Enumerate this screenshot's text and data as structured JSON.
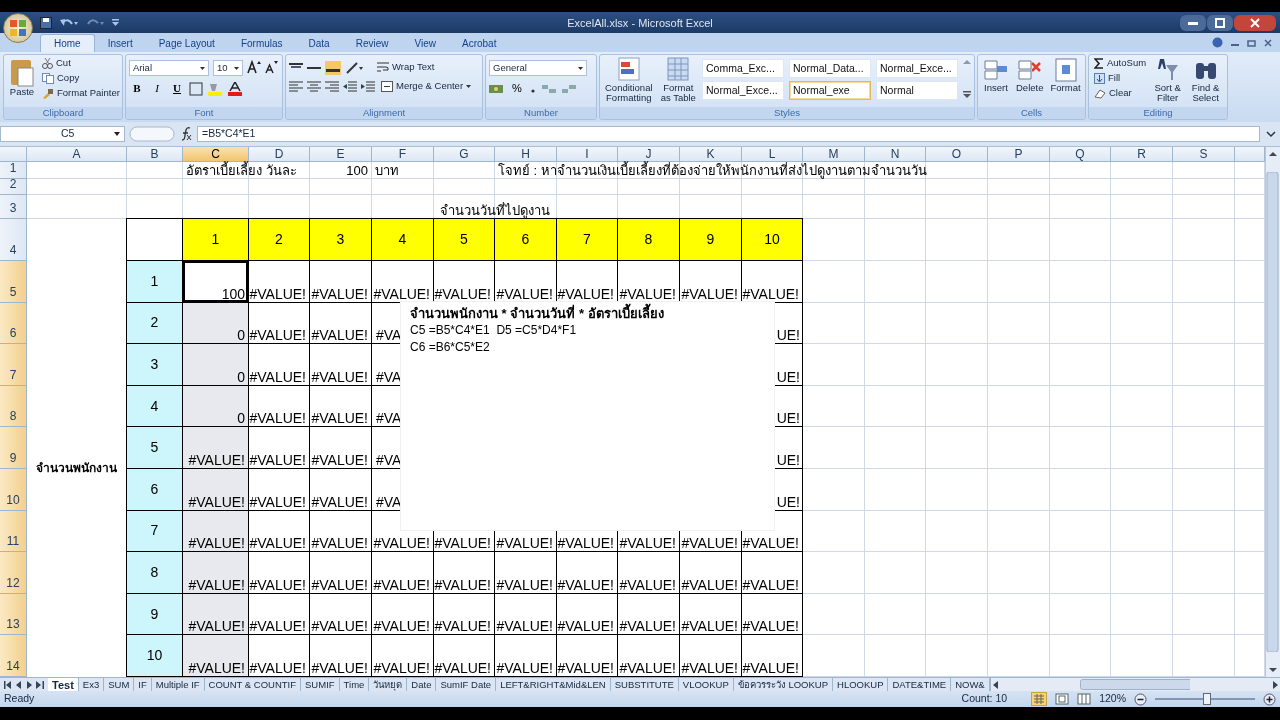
{
  "window": {
    "title": "ExcelAll.xlsx - Microsoft Excel"
  },
  "ribbon_tabs": [
    {
      "label": "Home",
      "selected": true
    },
    {
      "label": "Insert",
      "selected": false
    },
    {
      "label": "Page Layout",
      "selected": false
    },
    {
      "label": "Formulas",
      "selected": false
    },
    {
      "label": "Data",
      "selected": false
    },
    {
      "label": "Review",
      "selected": false
    },
    {
      "label": "View",
      "selected": false
    },
    {
      "label": "Acrobat",
      "selected": false
    }
  ],
  "ribbon": {
    "clipboard": {
      "label": "Clipboard",
      "paste": "Paste",
      "cut": "Cut",
      "copy": "Copy",
      "format_painter": "Format Painter"
    },
    "font": {
      "label": "Font",
      "font_name": "Arial",
      "font_size": "10",
      "bold": "B",
      "italic": "I",
      "underline": "U"
    },
    "alignment": {
      "label": "Alignment",
      "wrap_text": "Wrap Text",
      "merge_center": "Merge & Center"
    },
    "number": {
      "label": "Number",
      "format": "General",
      "percent": "%"
    },
    "styles": {
      "label": "Styles",
      "conditional_formatting": "Conditional Formatting",
      "format_as_table": "Format as Table",
      "cell_styles": [
        {
          "label": "Comma_Exc...",
          "selected": false
        },
        {
          "label": "Normal_Data...",
          "selected": false
        },
        {
          "label": "Normal_Exce...",
          "selected": false
        },
        {
          "label": "Normal_Exce...",
          "selected": false
        },
        {
          "label": "Normal_exe",
          "selected": true
        },
        {
          "label": "Normal",
          "selected": false
        }
      ]
    },
    "cells": {
      "label": "Cells",
      "insert": "Insert",
      "delete": "Delete",
      "format": "Format"
    },
    "editing": {
      "label": "Editing",
      "autosum": "AutoSum",
      "fill": "Fill",
      "clear": "Clear",
      "sort_filter": "Sort & Filter",
      "find_select": "Find & Select"
    }
  },
  "formula_bar": {
    "name_box": "C5",
    "formula": "=B5*C4*E1"
  },
  "sheet": {
    "columns": [
      {
        "label": "A",
        "selected": false
      },
      {
        "label": "B",
        "selected": false
      },
      {
        "label": "C",
        "selected": true
      },
      {
        "label": "D",
        "selected": false
      },
      {
        "label": "E",
        "selected": false
      },
      {
        "label": "F",
        "selected": false
      },
      {
        "label": "G",
        "selected": false
      },
      {
        "label": "H",
        "selected": false
      },
      {
        "label": "I",
        "selected": false
      },
      {
        "label": "J",
        "selected": false
      },
      {
        "label": "K",
        "selected": false
      },
      {
        "label": "L",
        "selected": false
      },
      {
        "label": "M",
        "selected": false
      },
      {
        "label": "N",
        "selected": false
      },
      {
        "label": "O",
        "selected": false
      },
      {
        "label": "P",
        "selected": false
      },
      {
        "label": "Q",
        "selected": false
      },
      {
        "label": "R",
        "selected": false
      },
      {
        "label": "S",
        "selected": false
      }
    ],
    "rows": [
      {
        "label": "1",
        "selected": false,
        "cells": [
          null,
          null,
          {
            "kind": "text",
            "text": "อัตราเบี้ยเลี้ยง วันละ"
          },
          null,
          {
            "kind": "number",
            "text": "100"
          },
          {
            "kind": "text",
            "text": "บาท"
          },
          null,
          {
            "kind": "text",
            "text": "โจทย์ : หาจำนวนเงินเบี้ยเลี้ยงที่ต้องจ่ายให้พนักงานที่ส่งไปดูงานตามจำนวนวัน"
          }
        ]
      },
      {
        "label": "2",
        "selected": false,
        "cells": []
      },
      {
        "label": "3",
        "selected": false,
        "cells": [
          null,
          null,
          null,
          null,
          null,
          null,
          {
            "kind": "title",
            "text": "จำนวนวันที่ไปดูงาน"
          }
        ]
      },
      {
        "label": "4",
        "selected": false,
        "cells": [
          null,
          null,
          {
            "kind": "day",
            "text": "1"
          },
          {
            "kind": "day",
            "text": "2"
          },
          {
            "kind": "day",
            "text": "3"
          },
          {
            "kind": "day",
            "text": "4"
          },
          {
            "kind": "day",
            "text": "5"
          },
          {
            "kind": "day",
            "text": "6"
          },
          {
            "kind": "day",
            "text": "7"
          },
          {
            "kind": "day",
            "text": "8"
          },
          {
            "kind": "day",
            "text": "9"
          },
          {
            "kind": "day",
            "text": "10"
          }
        ]
      },
      {
        "label": "5",
        "selected": true,
        "cells": [
          null,
          {
            "kind": "staff",
            "text": "1"
          },
          {
            "kind": "result",
            "text": "100"
          },
          {
            "kind": "result",
            "text": "#VALUE!"
          },
          {
            "kind": "result",
            "text": "#VALUE!"
          },
          {
            "kind": "result",
            "text": "#VALUE!"
          },
          {
            "kind": "result",
            "text": "#VALUE!"
          },
          {
            "kind": "result",
            "text": "#VALUE!"
          },
          {
            "kind": "result",
            "text": "#VALUE!"
          },
          {
            "kind": "result",
            "text": "#VALUE!"
          },
          {
            "kind": "result",
            "text": "#VALUE!"
          },
          {
            "kind": "result",
            "text": "#VALUE!"
          }
        ]
      },
      {
        "label": "6",
        "selected": true,
        "cells": [
          null,
          {
            "kind": "staff",
            "text": "2"
          },
          {
            "kind": "result",
            "text": "0"
          },
          {
            "kind": "result",
            "text": "#VALUE!"
          },
          {
            "kind": "result",
            "text": "#VALUE!"
          },
          {
            "kind": "cut_right",
            "text": "#VA"
          },
          null,
          null,
          null,
          null,
          null,
          {
            "kind": "cut_left",
            "text": "UE!"
          }
        ]
      },
      {
        "label": "7",
        "selected": true,
        "cells": [
          null,
          {
            "kind": "staff",
            "text": "3"
          },
          {
            "kind": "result",
            "text": "0"
          },
          {
            "kind": "result",
            "text": "#VALUE!"
          },
          {
            "kind": "result",
            "text": "#VALUE!"
          },
          {
            "kind": "cut_right",
            "text": "#VA"
          },
          null,
          null,
          null,
          null,
          null,
          {
            "kind": "cut_left",
            "text": "UE!"
          }
        ]
      },
      {
        "label": "8",
        "selected": true,
        "cells": [
          null,
          {
            "kind": "staff",
            "text": "4"
          },
          {
            "kind": "result",
            "text": "0"
          },
          {
            "kind": "result",
            "text": "#VALUE!"
          },
          {
            "kind": "result",
            "text": "#VALUE!"
          },
          {
            "kind": "cut_right",
            "text": "#VA"
          },
          null,
          null,
          null,
          null,
          null,
          {
            "kind": "cut_left",
            "text": "UE!"
          }
        ]
      },
      {
        "label": "9",
        "selected": true,
        "cells": [
          {
            "kind": "group",
            "text": "จำนวนพนักงาน"
          },
          {
            "kind": "staff",
            "text": "5"
          },
          {
            "kind": "result",
            "text": "#VALUE!"
          },
          {
            "kind": "result",
            "text": "#VALUE!"
          },
          {
            "kind": "result",
            "text": "#VALUE!"
          },
          {
            "kind": "cut_right",
            "text": "#VA"
          },
          null,
          null,
          null,
          null,
          null,
          {
            "kind": "cut_left",
            "text": "UE!"
          }
        ]
      },
      {
        "label": "10",
        "selected": true,
        "cells": [
          null,
          {
            "kind": "staff",
            "text": "6"
          },
          {
            "kind": "result",
            "text": "#VALUE!"
          },
          {
            "kind": "result",
            "text": "#VALUE!"
          },
          {
            "kind": "result",
            "text": "#VALUE!"
          },
          {
            "kind": "cut_right",
            "text": "#VA"
          },
          null,
          null,
          null,
          null,
          null,
          {
            "kind": "cut_left",
            "text": "UE!"
          }
        ]
      },
      {
        "label": "11",
        "selected": true,
        "cells": [
          null,
          {
            "kind": "staff",
            "text": "7"
          },
          {
            "kind": "result",
            "text": "#VALUE!"
          },
          {
            "kind": "result",
            "text": "#VALUE!"
          },
          {
            "kind": "result",
            "text": "#VALUE!"
          },
          {
            "kind": "result",
            "text": "#VALUE!"
          },
          {
            "kind": "result",
            "text": "#VALUE!"
          },
          {
            "kind": "result",
            "text": "#VALUE!"
          },
          {
            "kind": "result",
            "text": "#VALUE!"
          },
          {
            "kind": "result",
            "text": "#VALUE!"
          },
          {
            "kind": "result",
            "text": "#VALUE!"
          },
          {
            "kind": "result",
            "text": "#VALUE!"
          }
        ]
      },
      {
        "label": "12",
        "selected": true,
        "cells": [
          null,
          {
            "kind": "staff",
            "text": "8"
          },
          {
            "kind": "result",
            "text": "#VALUE!"
          },
          {
            "kind": "result",
            "text": "#VALUE!"
          },
          {
            "kind": "result",
            "text": "#VALUE!"
          },
          {
            "kind": "result",
            "text": "#VALUE!"
          },
          {
            "kind": "result",
            "text": "#VALUE!"
          },
          {
            "kind": "result",
            "text": "#VALUE!"
          },
          {
            "kind": "result",
            "text": "#VALUE!"
          },
          {
            "kind": "result",
            "text": "#VALUE!"
          },
          {
            "kind": "result",
            "text": "#VALUE!"
          },
          {
            "kind": "result",
            "text": "#VALUE!"
          }
        ]
      },
      {
        "label": "13",
        "selected": true,
        "cells": [
          null,
          {
            "kind": "staff",
            "text": "9"
          },
          {
            "kind": "result",
            "text": "#VALUE!"
          },
          {
            "kind": "result",
            "text": "#VALUE!"
          },
          {
            "kind": "result",
            "text": "#VALUE!"
          },
          {
            "kind": "result",
            "text": "#VALUE!"
          },
          {
            "kind": "result",
            "text": "#VALUE!"
          },
          {
            "kind": "result",
            "text": "#VALUE!"
          },
          {
            "kind": "result",
            "text": "#VALUE!"
          },
          {
            "kind": "result",
            "text": "#VALUE!"
          },
          {
            "kind": "result",
            "text": "#VALUE!"
          },
          {
            "kind": "result",
            "text": "#VALUE!"
          }
        ]
      },
      {
        "label": "14",
        "selected": true,
        "cells": [
          null,
          {
            "kind": "staff",
            "text": "10"
          },
          {
            "kind": "result",
            "text": "#VALUE!"
          },
          {
            "kind": "result",
            "text": "#VALUE!"
          },
          {
            "kind": "result",
            "text": "#VALUE!"
          },
          {
            "kind": "result",
            "text": "#VALUE!"
          },
          {
            "kind": "result",
            "text": "#VALUE!"
          },
          {
            "kind": "result",
            "text": "#VALUE!"
          },
          {
            "kind": "result",
            "text": "#VALUE!"
          },
          {
            "kind": "result",
            "text": "#VALUE!"
          },
          {
            "kind": "result",
            "text": "#VALUE!"
          },
          {
            "kind": "result",
            "text": "#VALUE!"
          }
        ]
      }
    ]
  },
  "text_box": {
    "heading": "จำนวนพนักงาน * จำนวนวันที่ * อัตราเบี้ยเลี้ยง",
    "lines": [
      "C5 =B5*C4*E1  D5 =C5*D4*F1",
      "C6 =B6*C5*E2"
    ]
  },
  "sheet_tabs": [
    {
      "label": "Test",
      "selected": true
    },
    {
      "label": "Ex3",
      "selected": false
    },
    {
      "label": "SUM",
      "selected": false
    },
    {
      "label": "IF",
      "selected": false
    },
    {
      "label": "Multiple IF",
      "selected": false
    },
    {
      "label": "COUNT & COUNTIF",
      "selected": false
    },
    {
      "label": "SUMIF",
      "selected": false
    },
    {
      "label": "Time",
      "selected": false
    },
    {
      "label": "วันหยุด",
      "selected": false
    },
    {
      "label": "Date",
      "selected": false
    },
    {
      "label": "SumIF Date",
      "selected": false
    },
    {
      "label": "LEFT&RIGHT&Mid&LEN",
      "selected": false
    },
    {
      "label": "SUBSTITUTE",
      "selected": false
    },
    {
      "label": "VLOOKUP",
      "selected": false
    },
    {
      "label": "ข้อควรระวัง LOOKUP",
      "selected": false
    },
    {
      "label": "HLOOKUP",
      "selected": false
    },
    {
      "label": "DATE&TIME",
      "selected": false
    },
    {
      "label": "NOW&",
      "selected": false
    }
  ],
  "status_bar": {
    "mode": "Ready",
    "count": "Count: 10",
    "zoom": "120%",
    "zoom_slider": {
      "level": 0.52
    }
  }
}
